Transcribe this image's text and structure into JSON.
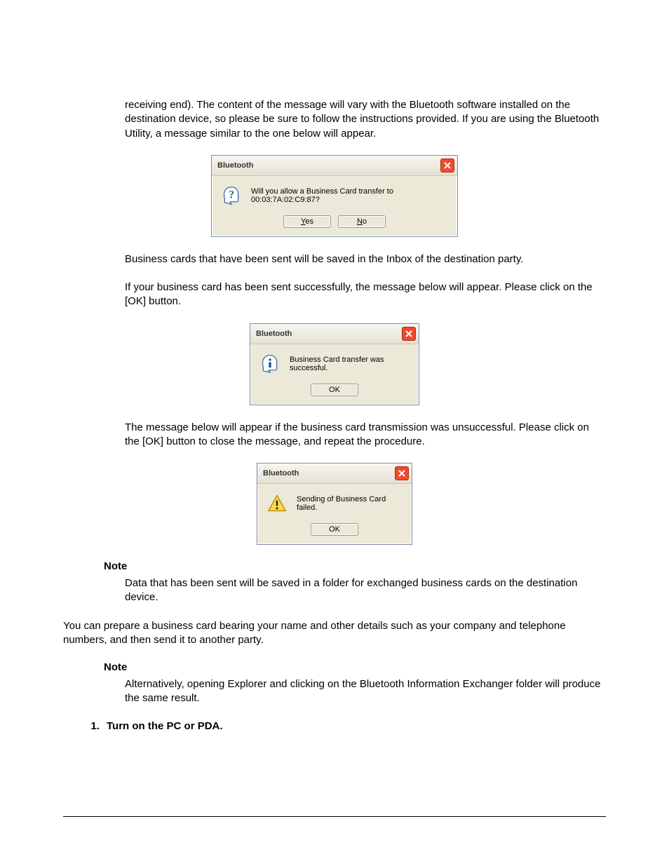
{
  "para1": "receiving end). The content of the message will vary with the Bluetooth software installed on the destination device, so please be sure to follow the instructions provided. If you are using the Bluetooth Utility, a message similar to the one below will appear.",
  "para2": "Business cards that have been sent will be saved in the Inbox of the destination party.",
  "para3": "If your business card has been sent successfully, the message below will appear. Please click on the [OK] button.",
  "para4": "The message below will appear if the business card transmission was unsuccessful. Please click on the [OK] button to close the message, and repeat the procedure.",
  "note1": {
    "label": "Note",
    "text": "Data that has been sent will be saved in a folder for exchanged business cards on the destination device."
  },
  "para5": "You can prepare a business card bearing your name and other details such as your company and telephone numbers, and then send it to another party.",
  "note2": {
    "label": "Note",
    "text": "Alternatively, opening Explorer and clicking on the Bluetooth Information Exchanger folder will produce the same result."
  },
  "step1": "Turn on the PC or PDA.",
  "dialog1": {
    "title": "Bluetooth",
    "message": "Will you allow a Business Card transfer to 00:03:7A:02:C9:87?",
    "yes": "Yes",
    "no": "No"
  },
  "dialog2": {
    "title": "Bluetooth",
    "message": "Business Card transfer was successful.",
    "ok": "OK"
  },
  "dialog3": {
    "title": "Bluetooth",
    "message": "Sending of Business Card failed.",
    "ok": "OK"
  }
}
